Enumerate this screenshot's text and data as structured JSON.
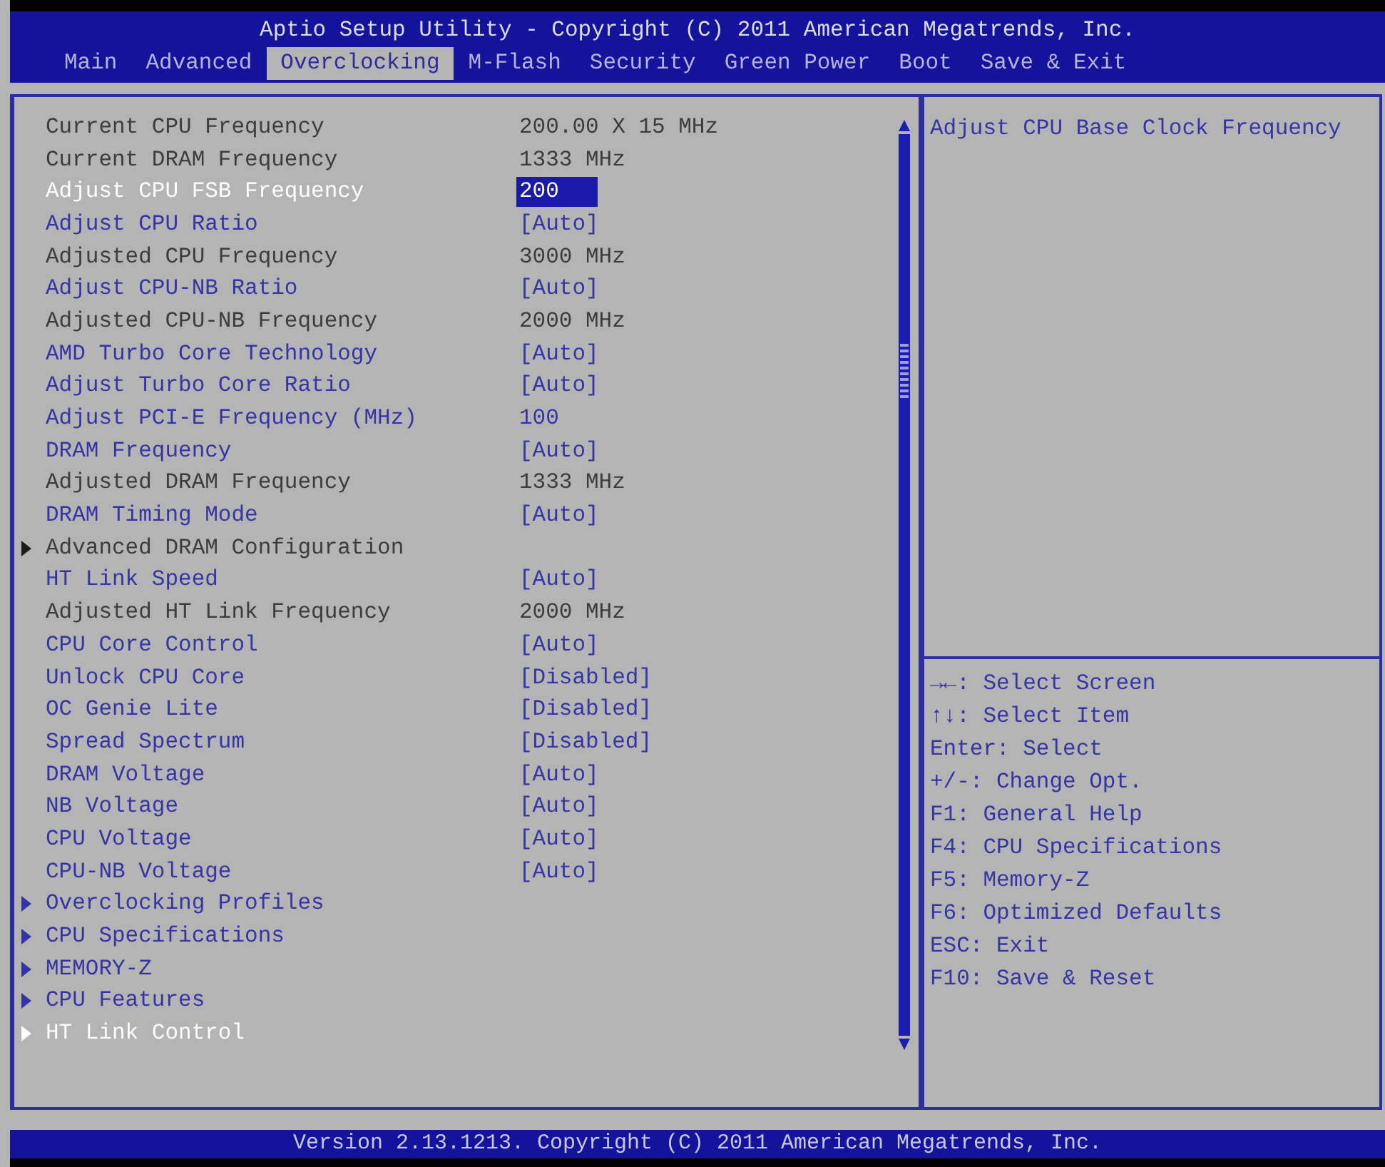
{
  "header": {
    "title": "Aptio Setup Utility - Copyright (C) 2011 American Megatrends, Inc.",
    "tabs": [
      {
        "label": "Main",
        "selected": false
      },
      {
        "label": "Advanced",
        "selected": false
      },
      {
        "label": "Overclocking",
        "selected": true
      },
      {
        "label": "M-Flash",
        "selected": false
      },
      {
        "label": "Security",
        "selected": false
      },
      {
        "label": "Green Power",
        "selected": false
      },
      {
        "label": "Boot",
        "selected": false
      },
      {
        "label": "Save & Exit",
        "selected": false
      }
    ]
  },
  "settings": {
    "rows": [
      {
        "kind": "setting",
        "label": "Current CPU Frequency",
        "value": "200.00 X 15 MHz",
        "editable": false,
        "selected": false
      },
      {
        "kind": "setting",
        "label": "Current DRAM Frequency",
        "value": "1333 MHz",
        "editable": false,
        "selected": false
      },
      {
        "kind": "setting",
        "label": "Adjust CPU FSB Frequency",
        "value": "200",
        "editable": true,
        "selected": true
      },
      {
        "kind": "setting",
        "label": "Adjust CPU Ratio",
        "value": "[Auto]",
        "editable": true,
        "selected": false
      },
      {
        "kind": "setting",
        "label": "Adjusted CPU Frequency",
        "value": "3000 MHz",
        "editable": false,
        "selected": false
      },
      {
        "kind": "setting",
        "label": "Adjust CPU-NB Ratio",
        "value": "[Auto]",
        "editable": true,
        "selected": false
      },
      {
        "kind": "setting",
        "label": "Adjusted CPU-NB Frequency",
        "value": "2000 MHz",
        "editable": false,
        "selected": false
      },
      {
        "kind": "setting",
        "label": "AMD Turbo Core Technology",
        "value": "[Auto]",
        "editable": true,
        "selected": false
      },
      {
        "kind": "setting",
        "label": "Adjust Turbo Core Ratio",
        "value": "[Auto]",
        "editable": true,
        "selected": false
      },
      {
        "kind": "setting",
        "label": "Adjust PCI-E Frequency (MHz)",
        "value": "100",
        "editable": true,
        "selected": false
      },
      {
        "kind": "setting",
        "label": "DRAM Frequency",
        "value": "[Auto]",
        "editable": true,
        "selected": false
      },
      {
        "kind": "setting",
        "label": "Adjusted DRAM Frequency",
        "value": "1333 MHz",
        "editable": false,
        "selected": false
      },
      {
        "kind": "setting",
        "label": "DRAM Timing Mode",
        "value": "[Auto]",
        "editable": true,
        "selected": false
      },
      {
        "kind": "submenu",
        "label": "Advanced DRAM Configuration",
        "editable": false,
        "selected": false
      },
      {
        "kind": "setting",
        "label": "HT Link Speed",
        "value": "[Auto]",
        "editable": true,
        "selected": false
      },
      {
        "kind": "setting",
        "label": "Adjusted HT Link Frequency",
        "value": "2000 MHz",
        "editable": false,
        "selected": false
      },
      {
        "kind": "setting",
        "label": "CPU Core Control",
        "value": "[Auto]",
        "editable": true,
        "selected": false
      },
      {
        "kind": "setting",
        "label": "Unlock CPU Core",
        "value": "[Disabled]",
        "editable": true,
        "selected": false
      },
      {
        "kind": "setting",
        "label": "OC Genie Lite",
        "value": "[Disabled]",
        "editable": true,
        "selected": false
      },
      {
        "kind": "setting",
        "label": "Spread Spectrum",
        "value": "[Disabled]",
        "editable": true,
        "selected": false
      },
      {
        "kind": "setting",
        "label": "DRAM Voltage",
        "value": "[Auto]",
        "editable": true,
        "selected": false
      },
      {
        "kind": "setting",
        "label": "NB Voltage",
        "value": "[Auto]",
        "editable": true,
        "selected": false
      },
      {
        "kind": "setting",
        "label": "CPU Voltage",
        "value": "[Auto]",
        "editable": true,
        "selected": false
      },
      {
        "kind": "setting",
        "label": "CPU-NB Voltage",
        "value": "[Auto]",
        "editable": true,
        "selected": false
      },
      {
        "kind": "submenu",
        "label": "Overclocking Profiles",
        "editable": true,
        "selected": false
      },
      {
        "kind": "submenu",
        "label": "CPU Specifications",
        "editable": true,
        "selected": false
      },
      {
        "kind": "submenu",
        "label": "MEMORY-Z",
        "editable": true,
        "selected": false
      },
      {
        "kind": "submenu",
        "label": "CPU Features",
        "editable": true,
        "selected": false
      },
      {
        "kind": "submenu",
        "label": "HT Link Control",
        "editable": true,
        "selected": true
      }
    ]
  },
  "help": {
    "description": "Adjust CPU Base Clock Frequency",
    "keys": [
      "→←: Select Screen",
      "↑↓: Select Item",
      "Enter: Select",
      "+/-: Change Opt.",
      "F1: General Help",
      "F4: CPU Specifications",
      "F5: Memory-Z",
      "F6: Optimized Defaults",
      "ESC: Exit",
      "F10: Save & Reset"
    ]
  },
  "footer": {
    "version": "Version 2.13.1213. Copyright (C) 2011 American Megatrends, Inc."
  }
}
